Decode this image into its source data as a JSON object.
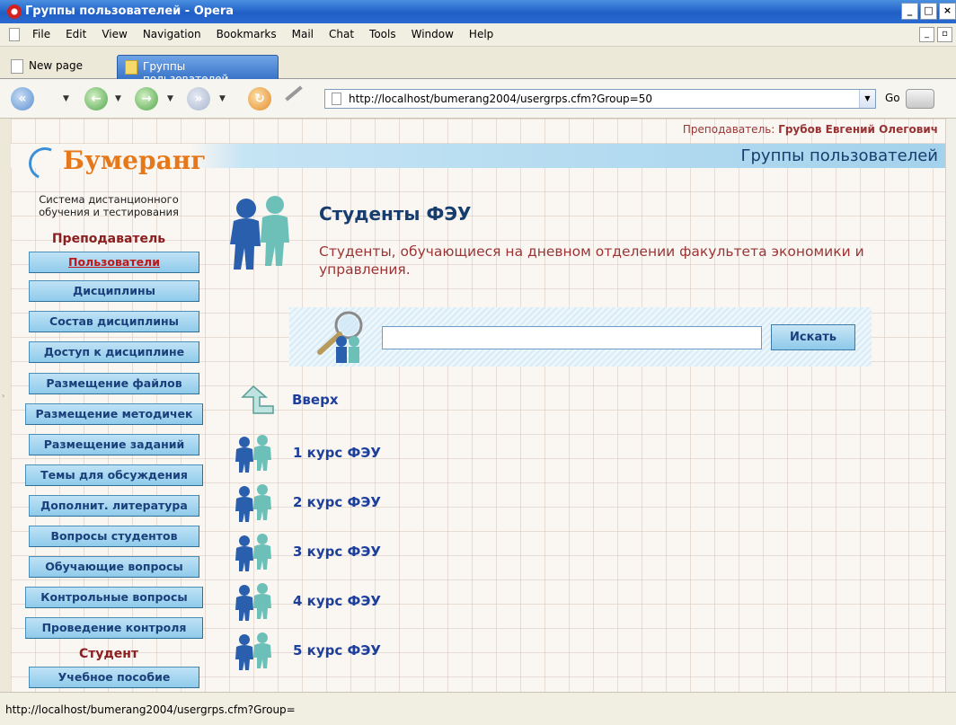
{
  "window": {
    "title": "Группы пользователей - Opera"
  },
  "menu": [
    "File",
    "Edit",
    "View",
    "Navigation",
    "Bookmarks",
    "Mail",
    "Chat",
    "Tools",
    "Window",
    "Help"
  ],
  "tabs": {
    "new": "New page",
    "active": "Группы пользователей"
  },
  "address": {
    "url": "http://localhost/bumerang2004/usergrps.cfm?Group=50",
    "go_label": "Go"
  },
  "page": {
    "teacher_prefix": "Преподаватель: ",
    "teacher_name": "Грубов Евгений Олегович",
    "section_title": "Группы пользователей",
    "brand": "Бумеранг",
    "tagline": "Система дистанционного обучения и тестирования",
    "role_teacher": "Преподаватель",
    "role_student": "Студент",
    "sidebar_teacher": [
      "Пользователи",
      "Дисциплины",
      "Состав дисциплины",
      "Доступ к дисциплине",
      "Размещение файлов",
      "Размещение методичек",
      "Размещение заданий",
      "Темы для обсуждения",
      "Дополнит. литература",
      "Вопросы студентов",
      "Обучающие вопросы",
      "Контрольные вопросы",
      "Проведение контроля"
    ],
    "sidebar_student": [
      "Учебное пособие"
    ],
    "group_title": "Студенты ФЭУ",
    "group_description": "Студенты, обучающиеся на дневном отделении факультета экономики и управления.",
    "search": {
      "value": "",
      "button": "Искать"
    },
    "up_label": "Вверх",
    "subgroups": [
      "1 курс ФЭУ",
      "2 курс ФЭУ",
      "3 курс ФЭУ",
      "4 курс ФЭУ",
      "5 курс ФЭУ"
    ]
  },
  "status": {
    "text": "http://localhost/bumerang2004/usergrps.cfm?Group="
  },
  "colors": {
    "brand_orange": "#e7781a",
    "nav_blue": "#8fcbeb",
    "link_blue": "#1d3f9c",
    "desc_red": "#9b3535"
  }
}
